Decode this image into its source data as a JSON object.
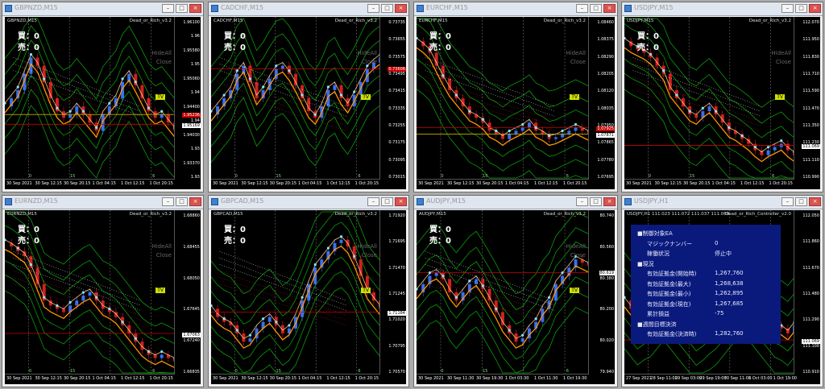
{
  "windows": [
    {
      "title": "GBPNZD,M15",
      "symbol": "GBPNZD,M15",
      "ea": "Dead_or_Rich_v3.2",
      "counts": [
        "買：0",
        "売：0"
      ],
      "hide": [
        "HideAll",
        "Close"
      ],
      "tv": "TV",
      "prices": [
        "1.96100",
        "1.96",
        "1.95580",
        "1.95",
        "1.95060",
        "1.94",
        "1.94400",
        "1.94",
        "1.94030",
        "1.93",
        "1.93370",
        "1.93"
      ],
      "tags": [
        {
          "text": "1.95169",
          "color": "#000000"
        },
        {
          "text": "1.95236",
          "color": "#cc0000"
        }
      ],
      "times": [
        "30 Sep 2021",
        "30 Sep 12:15",
        "30 Sep 20:15",
        "1 Oct 04:15",
        "1 Oct 12:15",
        "1 Oct 20:15"
      ],
      "overlay": [
        "0",
        "15",
        "6"
      ],
      "colors": {
        "price": "#ff9900",
        "band": "#0b9e0b"
      }
    },
    {
      "title": "CADCHF,M15",
      "symbol": "CADCHF,M15",
      "ea": "Dead_or_Rich_v3.2",
      "counts": [
        "買：0",
        "売：0"
      ],
      "hide": [
        "HideAll",
        "Close"
      ],
      "tv": "TV",
      "prices": [
        "0.73735",
        "0.73655",
        "0.73575",
        "0.73495",
        "0.73415",
        "0.73335",
        "0.73255",
        "0.73175",
        "0.73095",
        "0.73015"
      ],
      "tags": [
        {
          "text": "0.73606",
          "color": "#cc0000"
        }
      ],
      "times": [
        "30 Sep 2021",
        "30 Sep 12:15",
        "30 Sep 20:15",
        "1 Oct 04:15",
        "1 Oct 12:15",
        "1 Oct 20:15"
      ],
      "overlay": [
        "0",
        "15",
        "6"
      ]
    },
    {
      "title": "EURCHF,M15",
      "symbol": "EURCHF,M15",
      "ea": "Dead_or_Rich_v3.2",
      "counts": [
        "買：0",
        "売：0"
      ],
      "hide": [
        "HideAll",
        "Close"
      ],
      "tv": "TV",
      "prices": [
        "1.08460",
        "1.08375",
        "1.08290",
        "1.08205",
        "1.08120",
        "1.08035",
        "1.07950",
        "1.07865",
        "1.07780",
        "1.07695"
      ],
      "tags": [
        {
          "text": "1.07925",
          "color": "#cc0000"
        },
        {
          "text": "1.07871",
          "color": "#000000"
        }
      ],
      "times": [
        "30 Sep 2021",
        "30 Sep 12:15",
        "30 Sep 20:15",
        "1 Oct 04:15",
        "1 Oct 12:15",
        "1 Oct 20:15"
      ],
      "overlay": [
        "0",
        "15",
        "6"
      ]
    },
    {
      "title": "USDJPY,M15",
      "symbol": "USDJPY,M15",
      "ea": "Dead_or_Rich_v3.2",
      "counts": [
        "買：0",
        "売：0"
      ],
      "hide": [
        "HideAll",
        "Close"
      ],
      "tv": "TV",
      "prices": [
        "112.070",
        "111.950",
        "111.830",
        "111.710",
        "111.590",
        "111.470",
        "111.350",
        "111.230",
        "111.110",
        "110.990"
      ],
      "tags": [
        {
          "text": "111.069",
          "color": "#000000"
        }
      ],
      "times": [
        "30 Sep 2021",
        "30 Sep 12:15",
        "30 Sep 20:15",
        "1 Oct 04:15",
        "1 Oct 12:15",
        "1 Oct 20:15"
      ],
      "overlay": [
        "0",
        "15",
        "6"
      ]
    },
    {
      "title": "EURNZD,M15",
      "symbol": "EURNZD,M15",
      "ea": "Dead_or_Rich_v3.2",
      "counts": [
        "買：0",
        "売：0"
      ],
      "hide": [
        "HideAll",
        "Close"
      ],
      "tv": "TV",
      "prices": [
        "1.68860",
        "1.68455",
        "1.68050",
        "1.67645",
        "1.67240",
        "1.66835"
      ],
      "tags": [
        {
          "text": "1.67063",
          "color": "#000000"
        }
      ],
      "times": [
        "30 Sep 2021",
        "30 Sep 12:15",
        "30 Sep 20:15",
        "1 Oct 04:15",
        "1 Oct 12:15",
        "1 Oct 20:15"
      ],
      "overlay": [
        "0",
        "15",
        "6"
      ]
    },
    {
      "title": "GBPCAD,M15",
      "symbol": "GBPCAD,M15",
      "ea": "Dead_or_Rich_v3.2",
      "counts": [
        "買：0",
        "売：0"
      ],
      "hide": [
        "HideAll",
        "Close"
      ],
      "tv": "TV",
      "prices": [
        "1.71920",
        "1.71695",
        "1.71470",
        "1.71245",
        "1.71020",
        "1.70795",
        "1.70570"
      ],
      "tags": [
        {
          "text": "1.71184",
          "color": "#000000"
        }
      ],
      "times": [
        "30 Sep 2021",
        "30 Sep 12:15",
        "30 Sep 20:15",
        "1 Oct 04:15",
        "1 Oct 12:15",
        "1 Oct 20:15"
      ],
      "overlay": [
        "0",
        "15",
        "6"
      ]
    },
    {
      "title": "AUDJPY,M15",
      "symbol": "AUDJPY,M15",
      "ea": "Dead_or_Rich_v3.2",
      "counts": [
        "買：0",
        "売：0"
      ],
      "hide": [
        "HideAll",
        "Close"
      ],
      "tv": "TV",
      "prices": [
        "80.740",
        "80.560",
        "80.380",
        "80.200",
        "80.020",
        "79.940"
      ],
      "tags": [
        {
          "text": "80.619",
          "color": "#000000"
        }
      ],
      "times": [
        "30 Sep 2021",
        "30 Sep 11:30",
        "30 Sep 19:30",
        "1 Oct 03:30",
        "1 Oct 11:30",
        "1 Oct 19:30"
      ],
      "overlay": [
        "0",
        "15",
        "6"
      ]
    },
    {
      "title": "USDJPY,H1",
      "symbol": "USDJPY,H1  111.023 111.072 111.037 111.069",
      "ea": "Dead_or_Rich_Controller_v2.0",
      "prices": [
        "112.050",
        "111.860",
        "111.670",
        "111.480",
        "111.290",
        "111.100",
        "110.910"
      ],
      "tags": [
        {
          "text": "111.069",
          "color": "#000000"
        }
      ],
      "times": [
        "27 Sep 2021",
        "28 Sep 11:00",
        "29 Sep 03:00",
        "29 Sep 19:00",
        "30 Sep 11:00",
        "1 Oct 03:00",
        "1 Oct 19:00"
      ],
      "panel": {
        "rows": [
          {
            "h": "■制御対象EA"
          },
          {
            "k": "マジックナンバー",
            "v": "0"
          },
          {
            "k": "稼働状況",
            "v": "停止中"
          },
          {
            "h": "■現況"
          },
          {
            "k": "有効証拠金(開始時)",
            "v": "1,267,760"
          },
          {
            "k": "有効証拠金(最大)",
            "v": "1,268,638"
          },
          {
            "k": "有効証拠金(最小)",
            "v": "1,262,895"
          },
          {
            "k": "有効証拠金(現在)",
            "v": "1,267,685"
          },
          {
            "k": "累計損益",
            "v": "-75"
          },
          {
            "h": "■週間目標決済"
          },
          {
            "k": "有効証拠金(決済時)",
            "v": "1,282,760"
          }
        ]
      }
    }
  ]
}
